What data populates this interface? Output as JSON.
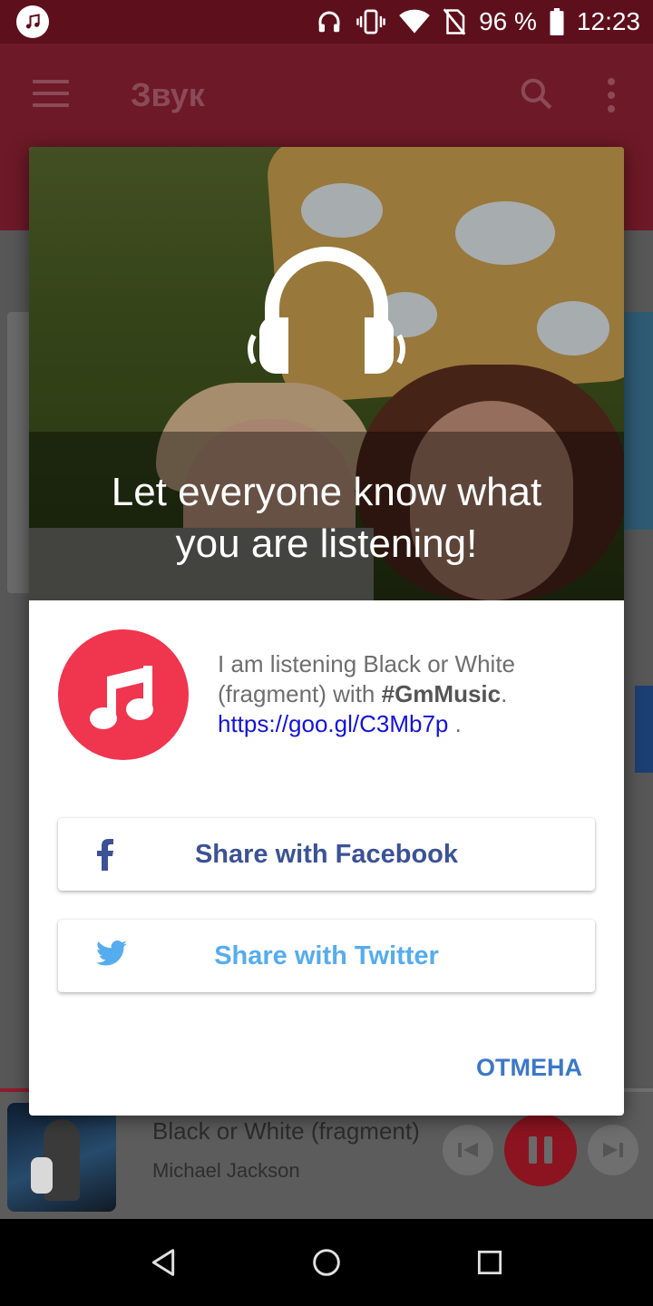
{
  "status_bar": {
    "battery": "96 %",
    "time": "12:23"
  },
  "app_bar": {
    "title": "Звук"
  },
  "dialog": {
    "hero_title_line1": "Let everyone know what",
    "hero_title_line2": "you are listening!",
    "message_prefix": "I am listening Black or White (fragment) with ",
    "message_hashtag": "#GmMusic",
    "message_period": ".",
    "message_link": "https://goo.gl/C3Mb7p",
    "message_suffix": " .",
    "facebook_button": "Share with Facebook",
    "twitter_button": "Share with Twitter",
    "cancel_button": "ОТМЕНА"
  },
  "player": {
    "track_title": "Black or White (fragment)",
    "artist": "Michael Jackson",
    "progress": 0.05
  },
  "colors": {
    "accent": "#f0354f",
    "facebook": "#3b5296",
    "twitter": "#55acee",
    "cancel": "#3c78c8",
    "link": "#1414d8"
  },
  "icons": [
    "music-note-icon",
    "headphones-icon",
    "vibrate-icon",
    "wifi-icon",
    "no-sim-icon",
    "battery-icon",
    "menu-icon",
    "search-icon",
    "more-icon",
    "facebook-icon",
    "twitter-icon",
    "previous-icon",
    "pause-icon",
    "next-icon",
    "back-icon",
    "home-icon",
    "recents-icon"
  ]
}
